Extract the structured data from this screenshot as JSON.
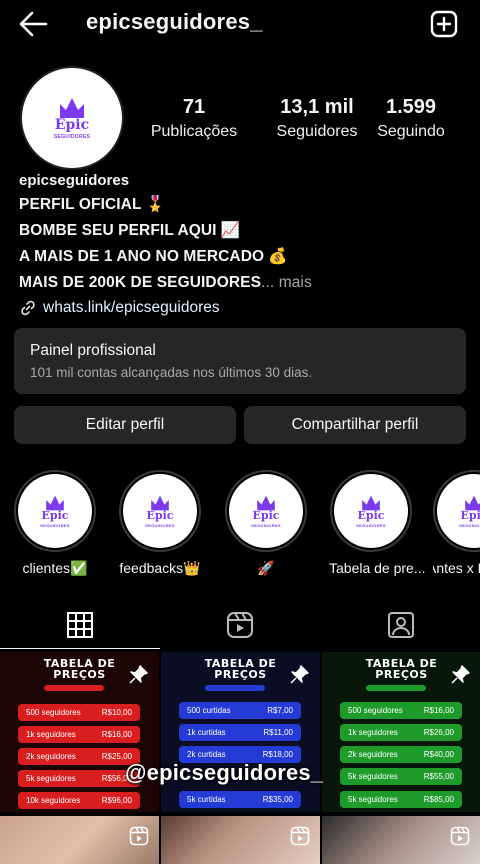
{
  "header": {
    "username": "epicseguidores_"
  },
  "profile": {
    "logo_text": "Epic",
    "logo_tag": "SEGUIDORES",
    "stats": {
      "posts": {
        "value": "71",
        "label": "Publicações"
      },
      "followers": {
        "value": "13,1 mil",
        "label": "Seguidores"
      },
      "following": {
        "value": "1.599",
        "label": "Seguindo"
      }
    },
    "name": "epicseguidores",
    "bio_lines": [
      {
        "text": "PERFIL OFICIAL",
        "emoji": "🎖️"
      },
      {
        "text": "BOMBE SEU PERFIL AQUI",
        "emoji": "📈"
      },
      {
        "text": "A MAIS DE 1 ANO NO MERCADO",
        "emoji": "💰"
      },
      {
        "text": "MAIS DE 200K DE SEGUIDORES",
        "more": "... mais"
      }
    ],
    "link": "whats.link/epicseguidores"
  },
  "dashboard": {
    "title": "Painel profissional",
    "subtitle": "101 mil contas alcançadas nos últimos 30 dias."
  },
  "buttons": {
    "edit": "Editar perfil",
    "share": "Compartilhar perfil"
  },
  "highlights": [
    {
      "label": "clientes✅"
    },
    {
      "label": "feedbacks👑"
    },
    {
      "label": "🚀"
    },
    {
      "label": "Tabela de pre..."
    },
    {
      "label": "Antes x D"
    }
  ],
  "tabs": [
    "grid-icon",
    "reels-icon",
    "tagged-icon"
  ],
  "posts": [
    {
      "title_1": "TABELA DE",
      "title_2": "PREÇOS",
      "rows": [
        {
          "item": "500 seguidores",
          "price": "R$10,00"
        },
        {
          "item": "1k seguidores",
          "price": "R$16,00"
        },
        {
          "item": "2k seguidores",
          "price": "R$25,00"
        },
        {
          "item": "5k seguidores",
          "price": "R$56,00"
        },
        {
          "item": "10k seguidores",
          "price": "R$96,00"
        }
      ]
    },
    {
      "title_1": "TABELA DE",
      "title_2": "PREÇOS",
      "rows": [
        {
          "item": "500 curtidas",
          "price": "R$7,00"
        },
        {
          "item": "1k curtidas",
          "price": "R$11,00"
        },
        {
          "item": "2k curtidas",
          "price": "R$18,00"
        },
        {
          "item": "5k curtidas",
          "price": "R$35,00"
        }
      ]
    },
    {
      "title_1": "TABELA DE",
      "title_2": "PREÇOS",
      "rows": [
        {
          "item": "500 seguidores",
          "price": "R$16,00"
        },
        {
          "item": "1k seguidores",
          "price": "R$26,00"
        },
        {
          "item": "2k seguidores",
          "price": "R$40,00"
        },
        {
          "item": "5k seguidores",
          "price": "R$55,00"
        },
        {
          "item": "5k seguidores",
          "price": "R$85,00"
        }
      ]
    }
  ],
  "watermark": "@epicseguidores_",
  "colors": {
    "background": "#000000",
    "card": "#262626",
    "logo_purple": "#7c3aed",
    "muted_text": "#a8a8a8"
  }
}
